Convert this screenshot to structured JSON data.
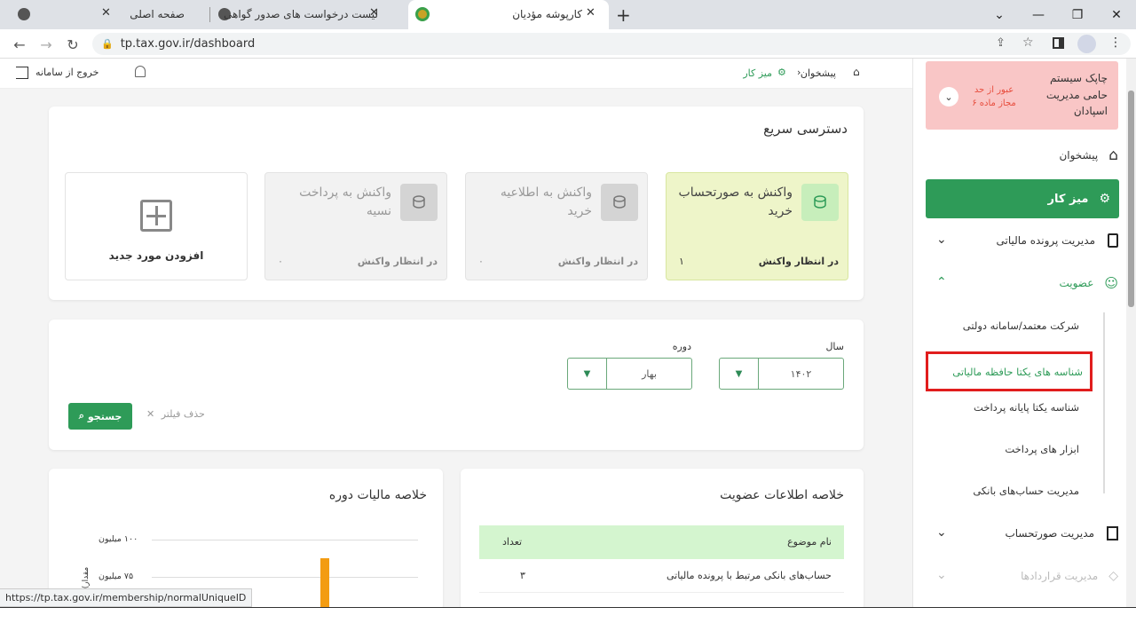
{
  "browser": {
    "tabs": [
      {
        "label": "صفحه اصلی"
      },
      {
        "label": "لیست درخواست های صدور گواهی"
      },
      {
        "label": "کارپوشه مؤدیان"
      }
    ],
    "url": "tp.tax.gov.ir/dashboard",
    "status_url": "https://tp.tax.gov.ir/membership/normalUniqueID"
  },
  "topbar": {
    "logout": "خروج از سامانه",
    "breadcrumb_home": "پیشخوان",
    "breadcrumb_current": "میز کار"
  },
  "quick_access": {
    "title": "دسترسی سریع",
    "cards": [
      {
        "title": "واکنش به صورتحساب خرید",
        "status": "در انتظار واکنش",
        "count": "۱"
      },
      {
        "title": "واکنش به اطلاعیه خرید",
        "status": "در انتظار واکنش",
        "count": "۰"
      },
      {
        "title": "واکنش به پرداخت نسیه",
        "status": "در انتظار واکنش",
        "count": "۰"
      }
    ],
    "add_label": "افزودن مورد جدید"
  },
  "filters": {
    "year_label": "سال",
    "year_value": "۱۴۰۲",
    "period_label": "دوره",
    "period_value": "بهار",
    "clear_label": "حذف فیلتر",
    "search_label": "جستجو"
  },
  "membership_summary": {
    "title": "خلاصه اطلاعات عضویت",
    "col_subject": "نام موضوع",
    "col_count": "تعداد",
    "rows": [
      {
        "subject": "حساب‌های بانکی مرتبط با پرونده مالیاتی",
        "count": "۳"
      }
    ]
  },
  "tax_summary": {
    "title": "خلاصه مالیات دوره",
    "ylabel": "(مقدار",
    "chart_data": {
      "type": "bar",
      "title": "خلاصه مالیات دوره",
      "ticks": [
        "۱۰۰ میلیون",
        "۷۵ میلیون"
      ],
      "bar_color": "#f39c12"
    }
  },
  "sidebar": {
    "alert": {
      "title": "چاپک سیستم حامی مدیریت اسپادان",
      "badge": "عبور از حد مجاز ماده ۶"
    },
    "items": [
      {
        "label": "پیشخوان"
      },
      {
        "label": "میز کار"
      },
      {
        "label": "مدیریت پرونده مالیاتی"
      },
      {
        "label": "عضویت"
      },
      {
        "label": "مدیریت صورتحساب"
      },
      {
        "label": "مدیریت قراردادها"
      }
    ],
    "membership_sub": [
      "شرکت معتمد/سامانه دولتی",
      "شناسه های یکتا حافظه مالیاتی",
      "شناسه یکتا پایانه پرداخت",
      "ابزار های پرداخت",
      "مدیریت حساب‌های بانکی"
    ]
  },
  "colors": {
    "accent": "#2e9b58",
    "highlight": "#e11d1d",
    "alert_bg": "#f9c6c6"
  }
}
